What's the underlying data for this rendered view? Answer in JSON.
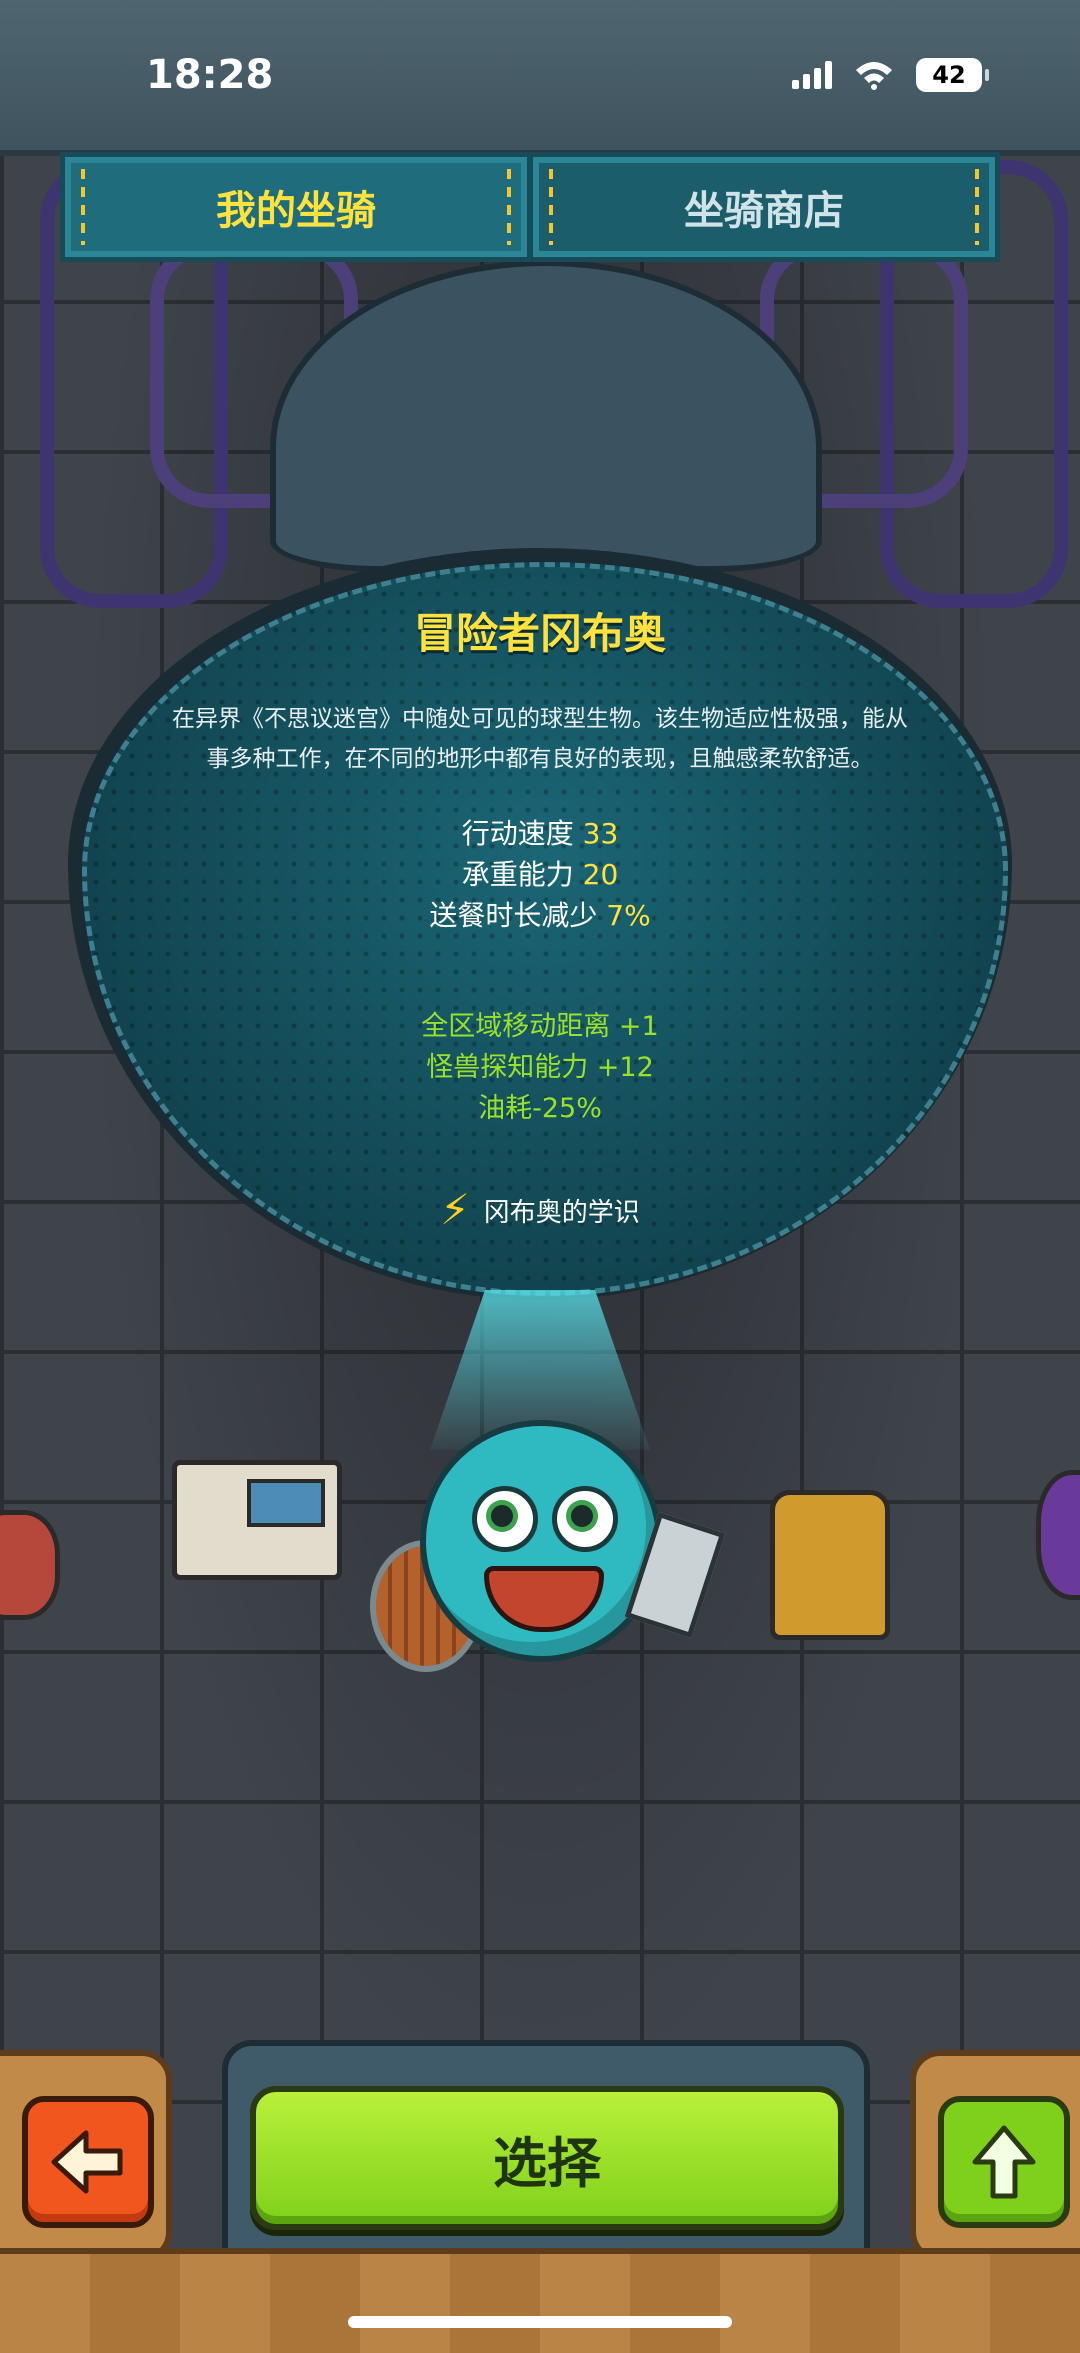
{
  "status_bar": {
    "time": "18:28",
    "battery": "42"
  },
  "tabs": [
    {
      "label": "我的坐骑",
      "active": true
    },
    {
      "label": "坐骑商店",
      "active": false
    }
  ],
  "mount": {
    "name": "冒险者冈布奥",
    "description": "在异界《不思议迷宫》中随处可见的球型生物。该生物适应性极强，能从事多种工作，在不同的地形中都有良好的表现，且触感柔软舒适。",
    "stats": [
      {
        "label": "行动速度",
        "value": "33"
      },
      {
        "label": "承重能力",
        "value": "20"
      },
      {
        "label": "送餐时长减少",
        "value": "7%"
      }
    ],
    "bonuses": [
      "全区域移动距离 +1",
      "怪兽探知能力 +12",
      "油耗-25%"
    ],
    "lore_link": "冈布奥的学识"
  },
  "buttons": {
    "select": "选择"
  },
  "colors": {
    "highlight": "#ffe23d",
    "bonus": "#9be12a",
    "select_green": "#8fdc1f",
    "back_orange": "#f2561f"
  },
  "icons": {
    "lore": "lightning-icon",
    "back": "arrow-left-icon",
    "up": "arrow-up-icon"
  }
}
